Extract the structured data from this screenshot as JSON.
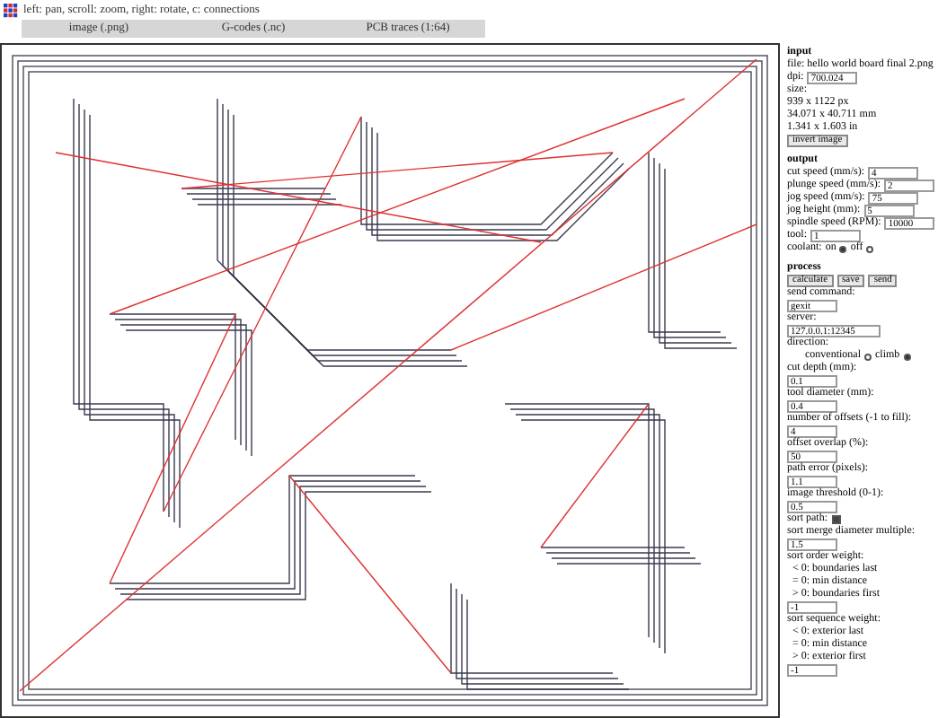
{
  "hint": "left: pan, scroll: zoom, right: rotate, c: connections",
  "tabs": [
    {
      "label": "image (.png)",
      "selected": false
    },
    {
      "label": "G-codes (.nc)",
      "selected": false
    },
    {
      "label": "PCB traces (1:64)",
      "selected": false
    }
  ],
  "sections": [
    {
      "title": "input",
      "items": [
        {
          "kind": "label",
          "text": "file: hello world board final 2.png"
        },
        {
          "kind": "field",
          "label": "dpi:",
          "value": "700.024"
        },
        {
          "kind": "label",
          "text": "size:"
        },
        {
          "kind": "label",
          "text": "939 x 1122 px"
        },
        {
          "kind": "label",
          "text": "34.071 x 40.711 mm"
        },
        {
          "kind": "label",
          "text": "1.341 x 1.603 in"
        },
        {
          "kind": "buttons",
          "buttons": [
            "invert image"
          ]
        }
      ]
    },
    {
      "title": "output",
      "items": [
        {
          "kind": "field",
          "label": "cut speed (mm/s):",
          "value": "4"
        },
        {
          "kind": "field",
          "label": "plunge speed (mm/s):",
          "value": "2"
        },
        {
          "kind": "field",
          "label": "jog speed (mm/s):",
          "value": "75"
        },
        {
          "kind": "field",
          "label": "jog height (mm):",
          "value": "5"
        },
        {
          "kind": "field",
          "label": "spindle speed (RPM):",
          "value": "10000"
        },
        {
          "kind": "field",
          "label": "tool:",
          "value": "1"
        },
        {
          "kind": "radio",
          "label": "coolant:",
          "options": [
            {
              "label": "on",
              "selected": true
            },
            {
              "label": "off",
              "selected": false
            }
          ]
        }
      ]
    },
    {
      "title": "process",
      "items": [
        {
          "kind": "buttons",
          "buttons": [
            "calculate",
            "save",
            "send"
          ]
        },
        {
          "kind": "label",
          "text": "send command:"
        },
        {
          "kind": "input",
          "value": "gexit"
        },
        {
          "kind": "label",
          "text": "server:"
        },
        {
          "kind": "input",
          "value": "127.0.0.1:12345"
        },
        {
          "kind": "label",
          "text": "direction:"
        },
        {
          "kind": "radio",
          "options": [
            {
              "label": "conventional",
              "selected": false
            },
            {
              "label": "climb",
              "selected": true
            }
          ]
        },
        {
          "kind": "label",
          "text": "cut depth (mm):"
        },
        {
          "kind": "input",
          "value": "0.1"
        },
        {
          "kind": "label",
          "text": "tool diameter (mm):"
        },
        {
          "kind": "input",
          "value": "0.4"
        },
        {
          "kind": "label",
          "text": "number of offsets (-1 to fill):"
        },
        {
          "kind": "input",
          "value": "4"
        },
        {
          "kind": "label",
          "text": "offset overlap (%):"
        },
        {
          "kind": "input",
          "value": "50"
        },
        {
          "kind": "label",
          "text": "path error (pixels):"
        },
        {
          "kind": "input",
          "value": "1.1"
        },
        {
          "kind": "label",
          "text": "image threshold (0-1):"
        },
        {
          "kind": "input",
          "value": "0.5"
        },
        {
          "kind": "checkbox",
          "label": "sort path:",
          "checked": true
        },
        {
          "kind": "label",
          "text": "sort merge diameter multiple:"
        },
        {
          "kind": "input",
          "value": "1.5"
        },
        {
          "kind": "label",
          "text": "sort order weight:"
        },
        {
          "kind": "note",
          "text": "< 0: boundaries last"
        },
        {
          "kind": "note",
          "text": "= 0: min distance"
        },
        {
          "kind": "note",
          "text": "> 0: boundaries first"
        },
        {
          "kind": "input",
          "value": "-1"
        },
        {
          "kind": "label",
          "text": "sort sequence weight:"
        },
        {
          "kind": "note",
          "text": "< 0: exterior last"
        },
        {
          "kind": "note",
          "text": "= 0: min distance"
        },
        {
          "kind": "note",
          "text": "> 0: exterior first"
        },
        {
          "kind": "input",
          "value": "-1"
        }
      ]
    }
  ]
}
